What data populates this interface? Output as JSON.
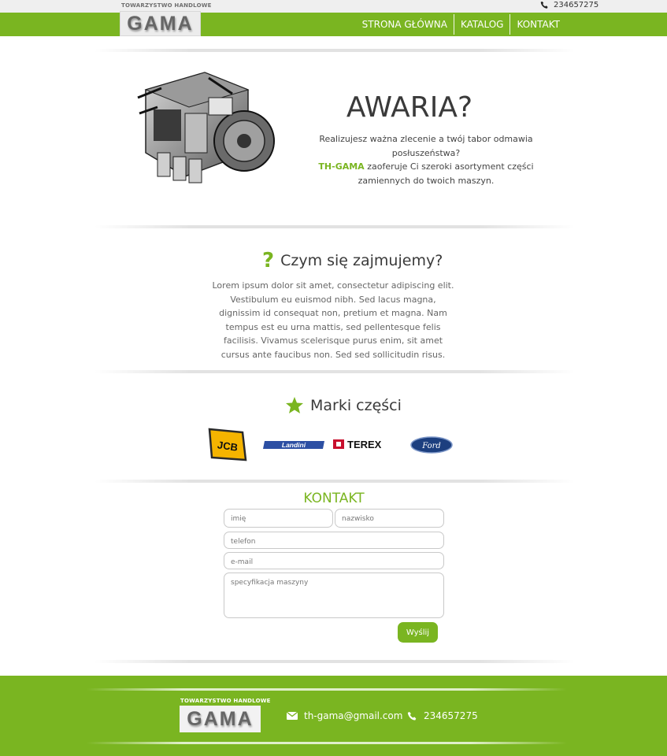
{
  "header": {
    "phone": "234657275",
    "logo": {
      "caption": "TOWARZYSTWO HANDLOWE",
      "word": "GAMA"
    },
    "menu": [
      "STRONA GŁÓWNA",
      "KATALOG",
      "KONTAKT"
    ]
  },
  "hero": {
    "title": "AWARIA?",
    "text_line1": "Realizujesz ważna zlecenie a twój tabor odmawia posłuszeństwa?",
    "brand": "TH-GAMA",
    "text_line2": " zaoferuje Ci szeroki asortyment części zamiennych do twoich maszyn."
  },
  "about": {
    "title": "Czym się zajmujemy?",
    "icon": "?",
    "text": "Lorem ipsum dolor sit amet, consectetur adipiscing elit. Vestibulum eu euismod nibh. Sed lacus magna, dignissim id consequat non, pretium et magna. Nam tempus est eu urna mattis, sed pellentesque felis facilisis. Vivamus scelerisque purus enim, sit amet cursus ante faucibus non. Sed sed sollicitudin risus."
  },
  "brands": {
    "title": "Marki części",
    "items": [
      "JCB",
      "Landini",
      "TEREX",
      "Ford"
    ]
  },
  "contact": {
    "title": "KONTAKT",
    "first_name_placeholder": "imię",
    "last_name_placeholder": "nazwisko",
    "phone_placeholder": "telefon",
    "email_placeholder": "e-mail",
    "spec_placeholder": "specyfikacja maszyny",
    "send_label": "Wyślij"
  },
  "footer": {
    "logo": {
      "caption": "TOWARZYSTWO HANDLOWE",
      "word": "GAMA"
    },
    "email": "th-gama@gmail.com",
    "phone": "234657275"
  },
  "colors": {
    "accent": "#7ab521",
    "topbar": "#efefef"
  }
}
